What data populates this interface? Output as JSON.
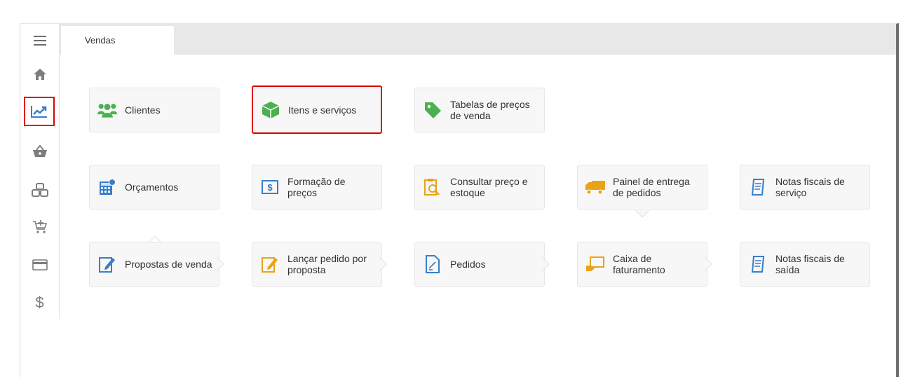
{
  "sidebar": {
    "items": [
      {
        "icon": "menu-icon"
      },
      {
        "icon": "home-icon"
      },
      {
        "icon": "sales-chart-icon",
        "active": true
      },
      {
        "icon": "basket-icon"
      },
      {
        "icon": "boxes-icon"
      },
      {
        "icon": "cart-add-icon"
      },
      {
        "icon": "card-icon"
      },
      {
        "icon": "dollar-icon",
        "glyph": "$"
      }
    ]
  },
  "tabs": [
    {
      "label": "Vendas"
    }
  ],
  "tiles": {
    "clientes": "Clientes",
    "itens": "Itens e serviços",
    "tabelas": "Tabelas de preços\nde venda",
    "orcamentos": "Orçamentos",
    "formacao": "Formação de\npreços",
    "consultar": "Consultar preço e\nestoque",
    "painel": "Painel de entrega\nde pedidos",
    "notas_servico": "Notas fiscais de\nserviço",
    "propostas": "Propostas de venda",
    "lancar": "Lançar pedido por\nproposta",
    "pedidos": "Pedidos",
    "caixa": "Caixa de\nfaturamento",
    "notas_saida": "Notas fiscais de\nsaída"
  },
  "colors": {
    "highlight": "#e00000",
    "accent_blue": "#3a7dc9",
    "accent_green": "#4caf50",
    "accent_orange": "#e8a317",
    "icon_gray": "#7d7d7d"
  }
}
